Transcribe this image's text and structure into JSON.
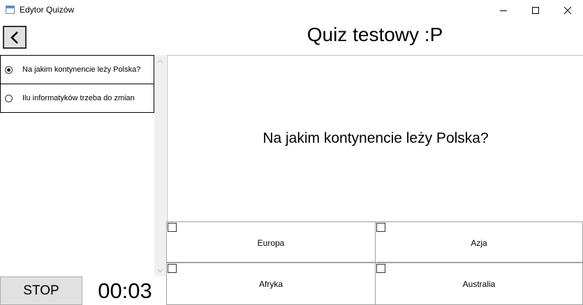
{
  "window": {
    "title": "Edytor Quizów"
  },
  "quiz": {
    "title": "Quiz testowy :P"
  },
  "questions": [
    {
      "label": "Na jakim kontynencie leży Polska?",
      "selected": true
    },
    {
      "label": "Ilu informatyków trzeba do zmian",
      "selected": false
    }
  ],
  "current_question": {
    "text": "Na jakim kontynencie leży Polska?",
    "answers": [
      {
        "label": "Europa",
        "checked": false
      },
      {
        "label": "Azja",
        "checked": false
      },
      {
        "label": "Afryka",
        "checked": false
      },
      {
        "label": "Australia",
        "checked": false
      }
    ]
  },
  "controls": {
    "stop_label": "STOP",
    "timer": "00:03"
  }
}
